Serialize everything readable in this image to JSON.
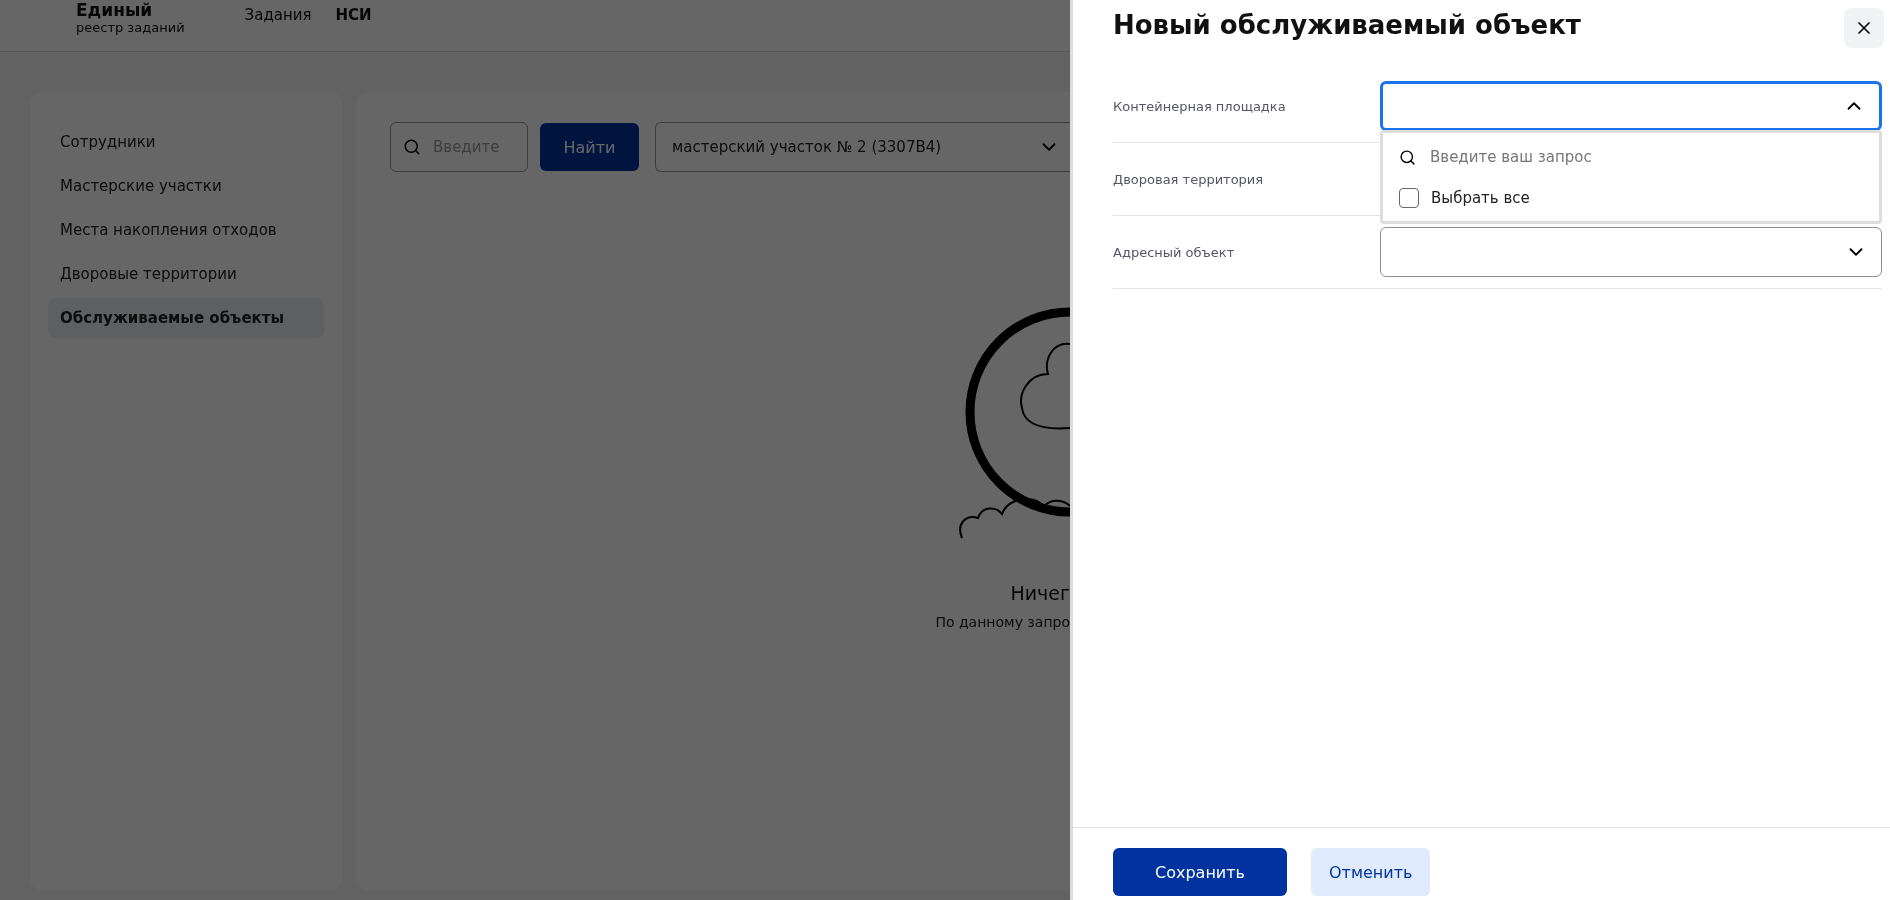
{
  "header": {
    "brand_title": "Единый",
    "brand_subtitle": "реестр заданий",
    "nav": [
      {
        "label": "Задания",
        "selected": false
      },
      {
        "label": "НСИ",
        "selected": true
      }
    ]
  },
  "sidebar": {
    "items": [
      {
        "label": "Сотрудники",
        "selected": false
      },
      {
        "label": "Мастерские участки",
        "selected": false
      },
      {
        "label": "Места накопления отходов",
        "selected": false
      },
      {
        "label": "Дворовые территории",
        "selected": false
      },
      {
        "label": "Обслуживаемые объекты",
        "selected": true
      }
    ]
  },
  "toolbar": {
    "search": {
      "placeholder": "Введите"
    },
    "find_button": "Найти",
    "filter": {
      "value": "мастерский участок № 2 (3307В4)"
    }
  },
  "empty_state": {
    "title": "Ничег",
    "text": "По данному запро"
  },
  "panel": {
    "title": "Новый обслуживаемый объект",
    "fields": [
      {
        "label": "Контейнерная площадка",
        "expanded": true,
        "dropdown": {
          "search_placeholder": "Введите ваш запрос",
          "select_all": {
            "label": "Выбрать все",
            "checked": false
          }
        }
      },
      {
        "label": "Дворовая территория",
        "expanded": false
      },
      {
        "label": "Адресный объект",
        "expanded": false
      }
    ],
    "buttons": [
      {
        "label": "Сохранить",
        "kind": "primary"
      },
      {
        "label": "Отменить",
        "kind": "secondary"
      }
    ]
  }
}
